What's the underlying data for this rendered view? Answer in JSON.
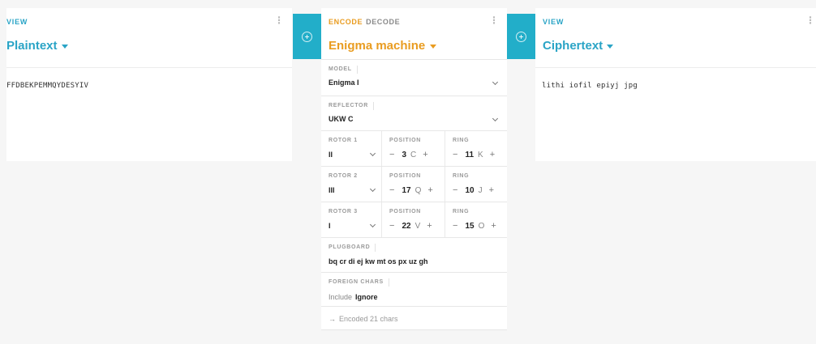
{
  "plaintext_panel": {
    "view_label": "VIEW",
    "title": "Plaintext",
    "menu_icon": "kebab-icon",
    "content": "FFDBEKPEMMQYDESYIV"
  },
  "add_buttons": {
    "icon": "add-circle-icon"
  },
  "enigma_panel": {
    "tabs": {
      "encode": "ENCODE",
      "decode": "DECODE"
    },
    "title": "Enigma machine",
    "model": {
      "label": "MODEL",
      "value": "Enigma I"
    },
    "reflector": {
      "label": "REFLECTOR",
      "value": "UKW C"
    },
    "rotors": [
      {
        "label": "ROTOR 1",
        "value": "II",
        "position_label": "POSITION",
        "position": "3",
        "position_letter": "C",
        "ring_label": "RING",
        "ring": "11",
        "ring_letter": "K"
      },
      {
        "label": "ROTOR 2",
        "value": "III",
        "position_label": "POSITION",
        "position": "17",
        "position_letter": "Q",
        "ring_label": "RING",
        "ring": "10",
        "ring_letter": "J"
      },
      {
        "label": "ROTOR 3",
        "value": "I",
        "position_label": "POSITION",
        "position": "22",
        "position_letter": "V",
        "ring_label": "RING",
        "ring": "15",
        "ring_letter": "O"
      }
    ],
    "stepper": {
      "minus": "−",
      "plus": "+"
    },
    "plugboard": {
      "label": "PLUGBOARD",
      "value": "bq cr di ej kw mt os px uz gh"
    },
    "foreign_chars": {
      "label": "FOREIGN CHARS",
      "option_include": "Include",
      "option_ignore": "Ignore"
    },
    "status": {
      "arrow": "→",
      "text": "Encoded 21 chars"
    }
  },
  "ciphertext_panel": {
    "view_label": "VIEW",
    "title": "Ciphertext",
    "content": "lithi iofil epiyj jpg"
  },
  "colors": {
    "view_accent": "#2aa4c6",
    "enigma_accent": "#e99c20",
    "add_column": "#22aec9"
  }
}
